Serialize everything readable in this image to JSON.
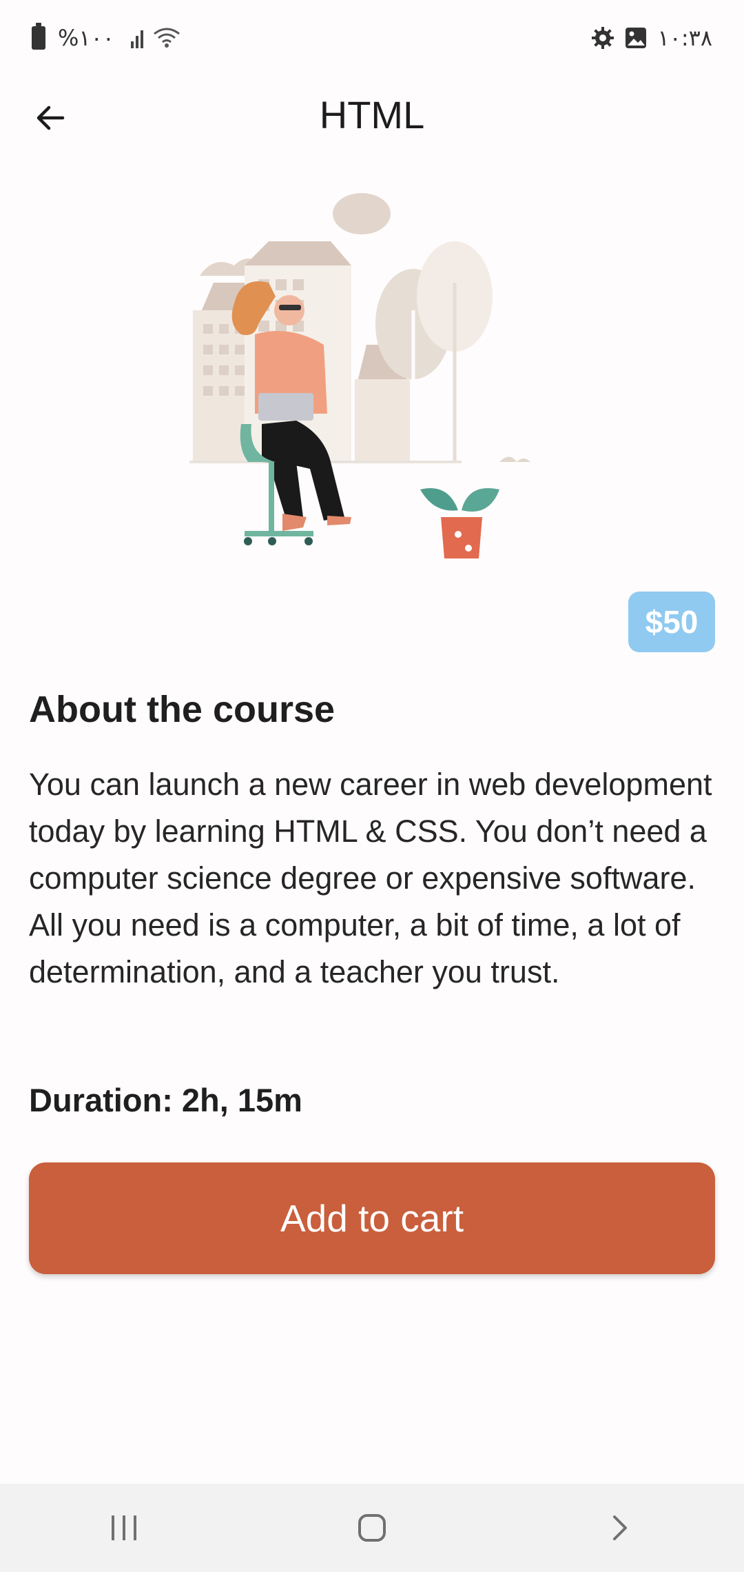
{
  "status_bar": {
    "battery_text": "%۱۰۰",
    "time": "۱۰:۳۸",
    "icons": [
      "battery-icon",
      "signal-icon",
      "wifi-icon",
      "settings-gear-icon",
      "gallery-image-icon"
    ]
  },
  "app_bar": {
    "title": "HTML",
    "back_icon": "arrow-left-icon"
  },
  "course": {
    "price": "$50",
    "about_title": "About the course",
    "description": "You can launch a new career in web development today by learning HTML & CSS. You don’t need a computer science degree or expensive software. All you need is a computer, a bit of time, a lot of determination, and a teacher you trust.",
    "duration": "Duration: 2h, 15m",
    "add_button_label": "Add to cart"
  },
  "nav_bar": {
    "icons": [
      "recent-apps-icon",
      "home-icon",
      "back-chevron-icon"
    ]
  },
  "colors": {
    "accent": "#c95f3c",
    "price_badge": "#90caf0",
    "background": "#fefcfc",
    "nav_background": "#f2f2f2"
  }
}
